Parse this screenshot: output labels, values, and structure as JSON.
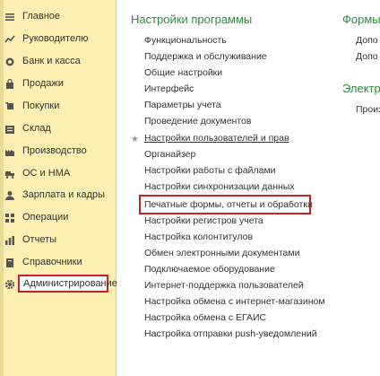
{
  "sidebar": {
    "items": [
      {
        "label": "Главное",
        "icon": "menu-icon"
      },
      {
        "label": "Руководителю",
        "icon": "trend-chart-icon"
      },
      {
        "label": "Банк и касса",
        "icon": "coins-icon"
      },
      {
        "label": "Продажи",
        "icon": "shopping-bag-icon"
      },
      {
        "label": "Покупки",
        "icon": "shopping-cart-icon"
      },
      {
        "label": "Склад",
        "icon": "warehouse-icon"
      },
      {
        "label": "Производство",
        "icon": "factory-icon"
      },
      {
        "label": "ОС и НМА",
        "icon": "truck-icon"
      },
      {
        "label": "Зарплата и кадры",
        "icon": "user-icon"
      },
      {
        "label": "Операции",
        "icon": "operations-icon"
      },
      {
        "label": "Отчеты",
        "icon": "bar-chart-icon"
      },
      {
        "label": "Справочники",
        "icon": "book-icon"
      },
      {
        "label": "Администрирование",
        "icon": "gear-icon"
      }
    ]
  },
  "sections": {
    "settings": {
      "title": "Настройки программы",
      "links": [
        "Функциональность",
        "Поддержка и обслуживание",
        "Общие настройки",
        "Интерфейс",
        "Параметры учета",
        "Проведение документов",
        "Настройки пользователей и прав",
        "Органайзер",
        "Настройки работы с файлами",
        "Настройки синхронизации данных",
        "Печатные формы, отчеты и обработки",
        "Настройки регистров учета",
        "Настройка колонтитулов",
        "Обмен электронными документами",
        "Подключаемое оборудование",
        "Интернет-поддержка пользователей",
        "Настройка обмена с интернет-магазином",
        "Настройка обмена с ЕГАИС",
        "Настройка отправки push-уведомлений"
      ]
    },
    "forms": {
      "title": "Формы",
      "links": [
        "Допо",
        "Допо"
      ]
    },
    "electro": {
      "title": "Электро",
      "links": [
        "Произ"
      ]
    }
  },
  "colors": {
    "sidebar_bg": "#fbf0b2",
    "section_title": "#2e8b3c",
    "highlight_border": "#cc2222"
  }
}
